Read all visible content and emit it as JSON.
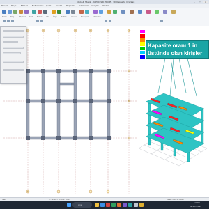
{
  "window": {
    "title": "ideCAD Statik · YAPI ÇELİK PROJE · 3D Kapasite Oranları",
    "min": "–",
    "max": "□",
    "close": "×"
  },
  "ribbon": {
    "tabs": [
      "Dosya",
      "Proje",
      "Mimari",
      "Betonarme",
      "Çelik",
      "Analiz",
      "Raporlar",
      "Görünüm",
      "Araçlar",
      "Yardım"
    ],
    "groups": [
      "Kolon",
      "Kiriş",
      "Döşeme",
      "Perde",
      "Temel",
      "Aks",
      "Ölçü",
      "Katlar",
      "Analiz",
      "Sonuçlar",
      "Görünüm"
    ]
  },
  "plan": {
    "axes_top": [
      "1",
      "2",
      "3",
      "4",
      "5",
      "6",
      "7"
    ],
    "axes_left": [
      "A",
      "B",
      "C",
      "D"
    ]
  },
  "view3d": {
    "callout_text": "Kapasite oranı 1 in üstünde olan kirişler var."
  },
  "legend": {
    "colors": [
      "#ff00ff",
      "#ff0000",
      "#ff8800",
      "#ffff00",
      "#00cc00",
      "#00ccff",
      "#0000ff"
    ]
  },
  "status": {
    "left": "Hazır",
    "coords": "X: 12.45  Y: 8.30  Z: 0.00",
    "right": "SNAP  ORTHO  GRID"
  },
  "taskbar": {
    "search_placeholder": "Ara",
    "time": "14:32",
    "date": "12.03.2024"
  }
}
